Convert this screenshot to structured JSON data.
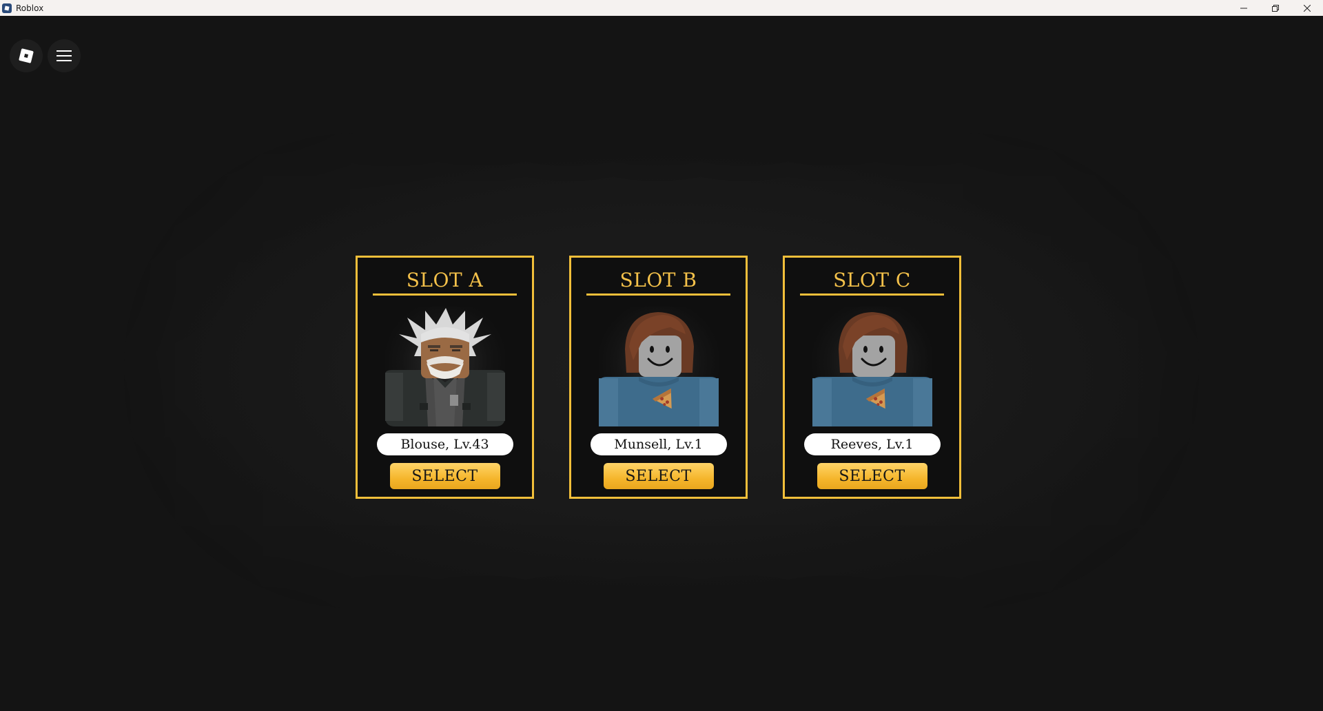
{
  "window": {
    "title": "Roblox",
    "icon": "roblox-logo-icon",
    "controls": [
      "minimize-icon",
      "restore-icon",
      "close-icon"
    ]
  },
  "topbar": {
    "roblox_menu_icon": "roblox-logo-icon",
    "hamburger_icon": "hamburger-menu-icon"
  },
  "slots": [
    {
      "title": "SLOT A",
      "character": "Blouse, Lv.43",
      "button": "SELECT",
      "avatar": "white-haired-bearded-soldier"
    },
    {
      "title": "SLOT B",
      "character": "Munsell, Lv.1",
      "button": "SELECT",
      "avatar": "default-face-brown-hair-blue-sweater"
    },
    {
      "title": "SLOT C",
      "character": "Reeves, Lv.1",
      "button": "SELECT",
      "avatar": "default-face-brown-hair-blue-sweater"
    }
  ],
  "colors": {
    "accent": "#f2bf3a",
    "background": "#141414",
    "card": "#0f0f0f"
  }
}
